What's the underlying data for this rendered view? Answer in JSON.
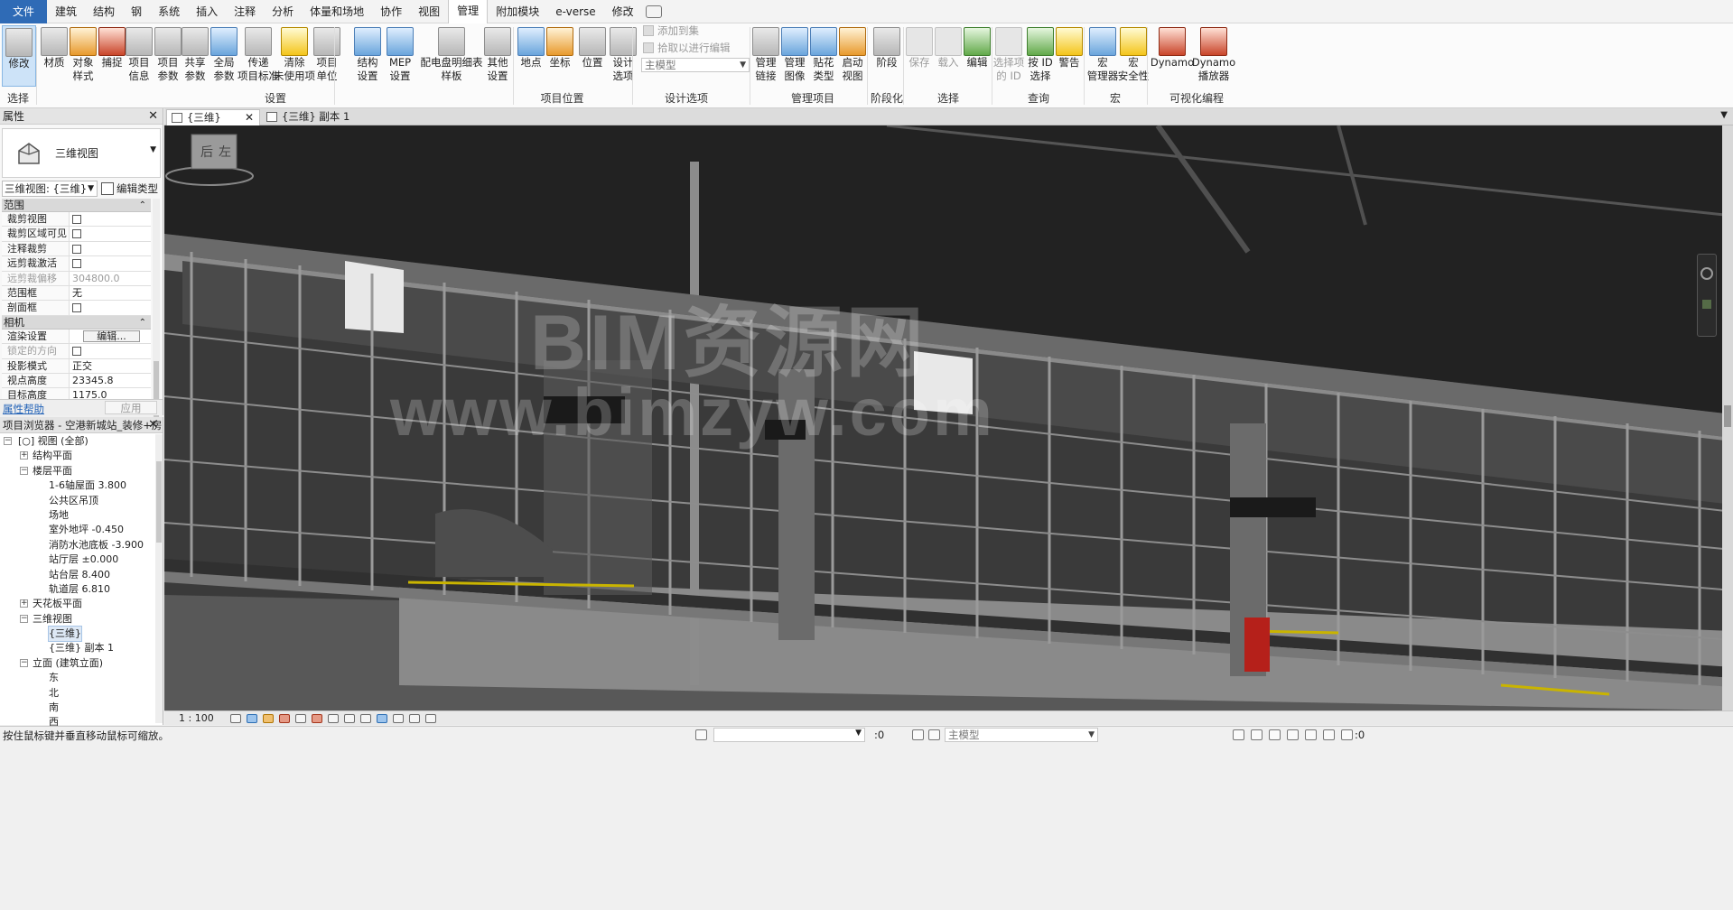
{
  "menu": {
    "items": [
      "文件",
      "建筑",
      "结构",
      "钢",
      "系统",
      "插入",
      "注释",
      "分析",
      "体量和场地",
      "协作",
      "视图",
      "管理",
      "附加模块",
      "e-verse",
      "修改"
    ],
    "active": "管理"
  },
  "ribbon": {
    "buttons": [
      {
        "label": "修改",
        "icon": "cursor-arrow-icon"
      },
      {
        "label": "材质",
        "icon": "material-sphere-icon"
      },
      {
        "label": "对象\n样式",
        "icon": "object-styles-icon"
      },
      {
        "label": "捕捉",
        "icon": "snap-magnet-icon"
      },
      {
        "label": "项目\n信息",
        "icon": "project-info-icon"
      },
      {
        "label": "项目\n参数",
        "icon": "project-parameters-icon"
      },
      {
        "label": "共享\n参数",
        "icon": "shared-parameters-icon"
      },
      {
        "label": "全局\n参数",
        "icon": "global-parameters-icon"
      },
      {
        "label": "传递\n项目标准",
        "icon": "transfer-standards-icon"
      },
      {
        "label": "清除\n未使用项",
        "icon": "purge-unused-icon"
      },
      {
        "label": "项目\n单位",
        "icon": "project-units-icon"
      },
      {
        "label": "结构\n设置",
        "icon": "structural-settings-icon"
      },
      {
        "label": "MEP\n设置",
        "icon": "mep-settings-icon"
      },
      {
        "label": "配电盘明细表\n样板",
        "icon": "panel-schedule-icon"
      },
      {
        "label": "其他\n设置",
        "icon": "other-settings-wrench-icon"
      },
      {
        "label": "地点",
        "icon": "location-globe-icon"
      },
      {
        "label": "坐标",
        "icon": "coordinates-icon"
      },
      {
        "label": "位置",
        "icon": "position-icon"
      },
      {
        "label": "设计\n选项",
        "icon": "design-options-icon"
      },
      {
        "label": "管理\n链接",
        "icon": "manage-links-icon"
      },
      {
        "label": "管理\n图像",
        "icon": "manage-images-icon"
      },
      {
        "label": "贴花\n类型",
        "icon": "decal-types-icon"
      },
      {
        "label": "启动\n视图",
        "icon": "starting-view-icon"
      },
      {
        "label": "阶段",
        "icon": "phases-icon"
      },
      {
        "label": "保存",
        "icon": "save-selection-icon"
      },
      {
        "label": "载入",
        "icon": "load-selection-icon"
      },
      {
        "label": "编辑",
        "icon": "edit-selection-icon"
      },
      {
        "label": "选择项\n的 ID",
        "icon": "ids-of-selection-icon"
      },
      {
        "label": "按 ID\n选择",
        "icon": "select-by-id-icon"
      },
      {
        "label": "警告",
        "icon": "warnings-icon"
      },
      {
        "label": "宏\n管理器",
        "icon": "macro-manager-icon"
      },
      {
        "label": "宏\n安全性",
        "icon": "macro-security-icon"
      },
      {
        "label": "Dynamo",
        "icon": "dynamo-icon"
      },
      {
        "label": "Dynamo\n播放器",
        "icon": "dynamo-player-icon"
      }
    ],
    "design_options": {
      "add_to_set": "添加到集",
      "pick_to_edit": "拾取以进行编辑",
      "main_model": "主模型"
    },
    "panels": [
      "选择",
      "设置",
      "项目位置",
      "设计选项",
      "管理项目",
      "阶段化",
      "选择",
      "查询",
      "宏",
      "可视化编程"
    ]
  },
  "properties": {
    "title": "属性",
    "type_name": "三维视图",
    "view_selector": "三维视图: {三维}",
    "edit_type": "编辑类型",
    "sections": [
      {
        "name": "范围",
        "rows": [
          {
            "key": "裁剪视图",
            "value": "",
            "checkbox": true,
            "dim": false
          },
          {
            "key": "裁剪区域可见",
            "value": "",
            "checkbox": true,
            "dim": false
          },
          {
            "key": "注释裁剪",
            "value": "",
            "checkbox": true,
            "dim": false
          },
          {
            "key": "远剪裁激活",
            "value": "",
            "checkbox": true,
            "dim": false
          },
          {
            "key": "远剪裁偏移",
            "value": "304800.0",
            "checkbox": false,
            "dim": true
          },
          {
            "key": "范围框",
            "value": "无",
            "checkbox": false,
            "dim": false
          },
          {
            "key": "剖面框",
            "value": "",
            "checkbox": true,
            "dim": false
          }
        ]
      },
      {
        "name": "相机",
        "rows": [
          {
            "key": "渲染设置",
            "value": "编辑...",
            "button": true,
            "dim": false
          },
          {
            "key": "锁定的方向",
            "value": "",
            "checkbox": true,
            "dim": true
          },
          {
            "key": "投影模式",
            "value": "正交",
            "dim": false
          },
          {
            "key": "视点高度",
            "value": "23345.8",
            "dim": false
          },
          {
            "key": "目标高度",
            "value": "1175.0",
            "dim": false
          }
        ]
      }
    ],
    "help_link": "属性帮助",
    "apply": "应用"
  },
  "browser": {
    "title": "项目浏览器 - 空港新城站_装修+房...",
    "tree": [
      {
        "label": "[○] 视图 (全部)",
        "level": 0,
        "toggle": "−"
      },
      {
        "label": "结构平面",
        "level": 1,
        "toggle": "+"
      },
      {
        "label": "楼层平面",
        "level": 1,
        "toggle": "−"
      },
      {
        "label": "1-6轴屋面 3.800",
        "level": 2
      },
      {
        "label": "公共区吊顶",
        "level": 2
      },
      {
        "label": "场地",
        "level": 2
      },
      {
        "label": "室外地坪 -0.450",
        "level": 2
      },
      {
        "label": "消防水池底板 -3.900",
        "level": 2
      },
      {
        "label": "站厅层 ±0.000",
        "level": 2
      },
      {
        "label": "站台层 8.400",
        "level": 2
      },
      {
        "label": "轨道层 6.810",
        "level": 2
      },
      {
        "label": "天花板平面",
        "level": 1,
        "toggle": "+"
      },
      {
        "label": "三维视图",
        "level": 1,
        "toggle": "−"
      },
      {
        "label": "{三维}",
        "level": 2,
        "selected": true
      },
      {
        "label": "{三维} 副本 1",
        "level": 2
      },
      {
        "label": "立面 (建筑立面)",
        "level": 1,
        "toggle": "−"
      },
      {
        "label": "东",
        "level": 2
      },
      {
        "label": "北",
        "level": 2
      },
      {
        "label": "南",
        "level": 2
      },
      {
        "label": "西",
        "level": 2
      }
    ]
  },
  "tabs": [
    {
      "label": "{三维}",
      "active": true
    },
    {
      "label": "{三维} 副本 1",
      "active": false
    }
  ],
  "viewport": {
    "watermark_line1": "BIM资源网",
    "watermark_line2": "www.bimzyw.com",
    "viewcube_left": "后",
    "viewcube_right": "左"
  },
  "view_control": {
    "scale": "1 : 100"
  },
  "status": {
    "message": "按住鼠标键并垂直移动鼠标可缩放。",
    "filter_count": ":0",
    "model": "主模型",
    "selection_count": ":0"
  }
}
